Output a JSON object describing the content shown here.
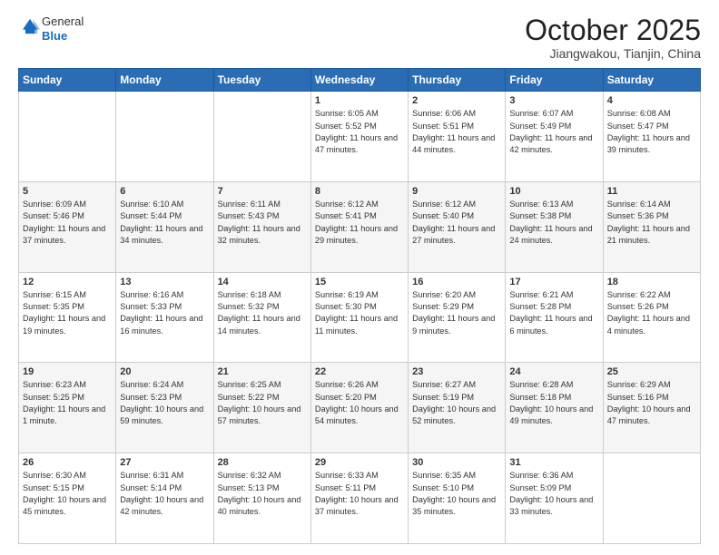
{
  "header": {
    "logo_line1": "General",
    "logo_line2": "Blue",
    "month": "October 2025",
    "location": "Jiangwakou, Tianjin, China"
  },
  "weekdays": [
    "Sunday",
    "Monday",
    "Tuesday",
    "Wednesday",
    "Thursday",
    "Friday",
    "Saturday"
  ],
  "weeks": [
    [
      {
        "day": "",
        "info": ""
      },
      {
        "day": "",
        "info": ""
      },
      {
        "day": "",
        "info": ""
      },
      {
        "day": "1",
        "info": "Sunrise: 6:05 AM\nSunset: 5:52 PM\nDaylight: 11 hours and 47 minutes."
      },
      {
        "day": "2",
        "info": "Sunrise: 6:06 AM\nSunset: 5:51 PM\nDaylight: 11 hours and 44 minutes."
      },
      {
        "day": "3",
        "info": "Sunrise: 6:07 AM\nSunset: 5:49 PM\nDaylight: 11 hours and 42 minutes."
      },
      {
        "day": "4",
        "info": "Sunrise: 6:08 AM\nSunset: 5:47 PM\nDaylight: 11 hours and 39 minutes."
      }
    ],
    [
      {
        "day": "5",
        "info": "Sunrise: 6:09 AM\nSunset: 5:46 PM\nDaylight: 11 hours and 37 minutes."
      },
      {
        "day": "6",
        "info": "Sunrise: 6:10 AM\nSunset: 5:44 PM\nDaylight: 11 hours and 34 minutes."
      },
      {
        "day": "7",
        "info": "Sunrise: 6:11 AM\nSunset: 5:43 PM\nDaylight: 11 hours and 32 minutes."
      },
      {
        "day": "8",
        "info": "Sunrise: 6:12 AM\nSunset: 5:41 PM\nDaylight: 11 hours and 29 minutes."
      },
      {
        "day": "9",
        "info": "Sunrise: 6:12 AM\nSunset: 5:40 PM\nDaylight: 11 hours and 27 minutes."
      },
      {
        "day": "10",
        "info": "Sunrise: 6:13 AM\nSunset: 5:38 PM\nDaylight: 11 hours and 24 minutes."
      },
      {
        "day": "11",
        "info": "Sunrise: 6:14 AM\nSunset: 5:36 PM\nDaylight: 11 hours and 21 minutes."
      }
    ],
    [
      {
        "day": "12",
        "info": "Sunrise: 6:15 AM\nSunset: 5:35 PM\nDaylight: 11 hours and 19 minutes."
      },
      {
        "day": "13",
        "info": "Sunrise: 6:16 AM\nSunset: 5:33 PM\nDaylight: 11 hours and 16 minutes."
      },
      {
        "day": "14",
        "info": "Sunrise: 6:18 AM\nSunset: 5:32 PM\nDaylight: 11 hours and 14 minutes."
      },
      {
        "day": "15",
        "info": "Sunrise: 6:19 AM\nSunset: 5:30 PM\nDaylight: 11 hours and 11 minutes."
      },
      {
        "day": "16",
        "info": "Sunrise: 6:20 AM\nSunset: 5:29 PM\nDaylight: 11 hours and 9 minutes."
      },
      {
        "day": "17",
        "info": "Sunrise: 6:21 AM\nSunset: 5:28 PM\nDaylight: 11 hours and 6 minutes."
      },
      {
        "day": "18",
        "info": "Sunrise: 6:22 AM\nSunset: 5:26 PM\nDaylight: 11 hours and 4 minutes."
      }
    ],
    [
      {
        "day": "19",
        "info": "Sunrise: 6:23 AM\nSunset: 5:25 PM\nDaylight: 11 hours and 1 minute."
      },
      {
        "day": "20",
        "info": "Sunrise: 6:24 AM\nSunset: 5:23 PM\nDaylight: 10 hours and 59 minutes."
      },
      {
        "day": "21",
        "info": "Sunrise: 6:25 AM\nSunset: 5:22 PM\nDaylight: 10 hours and 57 minutes."
      },
      {
        "day": "22",
        "info": "Sunrise: 6:26 AM\nSunset: 5:20 PM\nDaylight: 10 hours and 54 minutes."
      },
      {
        "day": "23",
        "info": "Sunrise: 6:27 AM\nSunset: 5:19 PM\nDaylight: 10 hours and 52 minutes."
      },
      {
        "day": "24",
        "info": "Sunrise: 6:28 AM\nSunset: 5:18 PM\nDaylight: 10 hours and 49 minutes."
      },
      {
        "day": "25",
        "info": "Sunrise: 6:29 AM\nSunset: 5:16 PM\nDaylight: 10 hours and 47 minutes."
      }
    ],
    [
      {
        "day": "26",
        "info": "Sunrise: 6:30 AM\nSunset: 5:15 PM\nDaylight: 10 hours and 45 minutes."
      },
      {
        "day": "27",
        "info": "Sunrise: 6:31 AM\nSunset: 5:14 PM\nDaylight: 10 hours and 42 minutes."
      },
      {
        "day": "28",
        "info": "Sunrise: 6:32 AM\nSunset: 5:13 PM\nDaylight: 10 hours and 40 minutes."
      },
      {
        "day": "29",
        "info": "Sunrise: 6:33 AM\nSunset: 5:11 PM\nDaylight: 10 hours and 37 minutes."
      },
      {
        "day": "30",
        "info": "Sunrise: 6:35 AM\nSunset: 5:10 PM\nDaylight: 10 hours and 35 minutes."
      },
      {
        "day": "31",
        "info": "Sunrise: 6:36 AM\nSunset: 5:09 PM\nDaylight: 10 hours and 33 minutes."
      },
      {
        "day": "",
        "info": ""
      }
    ]
  ]
}
